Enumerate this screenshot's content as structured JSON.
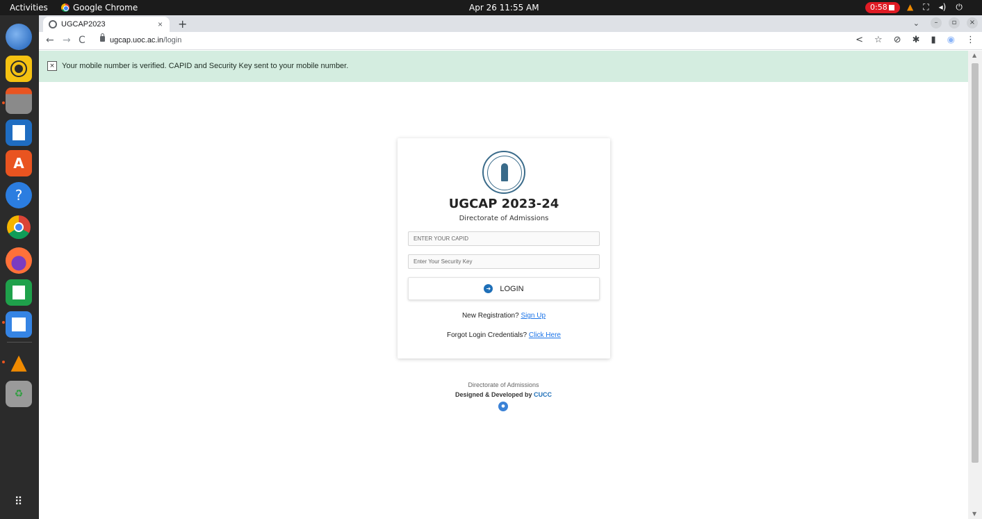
{
  "topbar": {
    "activities": "Activities",
    "app_name": "Google Chrome",
    "clock": "Apr 26  11:55 AM",
    "recording": "0:58"
  },
  "dock": {
    "items": [
      {
        "name": "thunderbird-icon"
      },
      {
        "name": "rhythmbox-icon"
      },
      {
        "name": "files-icon"
      },
      {
        "name": "writer-icon"
      },
      {
        "name": "app-center-icon"
      },
      {
        "name": "help-icon"
      },
      {
        "name": "chrome-icon"
      },
      {
        "name": "firefox-icon"
      },
      {
        "name": "calc-icon"
      },
      {
        "name": "text-editor-icon"
      },
      {
        "name": "vlc-icon"
      },
      {
        "name": "trash-icon"
      },
      {
        "name": "show-apps-icon"
      }
    ]
  },
  "browser": {
    "tab_title": "UGCAP2023",
    "url_domain": "ugcap.uoc.ac.in",
    "url_path": "/login"
  },
  "alert": {
    "close": "×",
    "message": "Your mobile number is verified. CAPID and Security Key sent to your mobile number."
  },
  "login": {
    "title": "UGCAP 2023-24",
    "subtitle": "Directorate of Admissions",
    "capid_placeholder": "ENTER YOUR CAPID",
    "security_placeholder": "Enter Your Security Key",
    "login_label": "LOGIN",
    "new_registration": "New Registration?",
    "sign_up": "Sign Up",
    "forgot": "Forgot Login Credentials?",
    "click_here": "Click Here"
  },
  "footer": {
    "line1": "Directorate of Admissions",
    "line2_prefix": "Designed & Developed by",
    "line2_brand": "CUCC"
  }
}
